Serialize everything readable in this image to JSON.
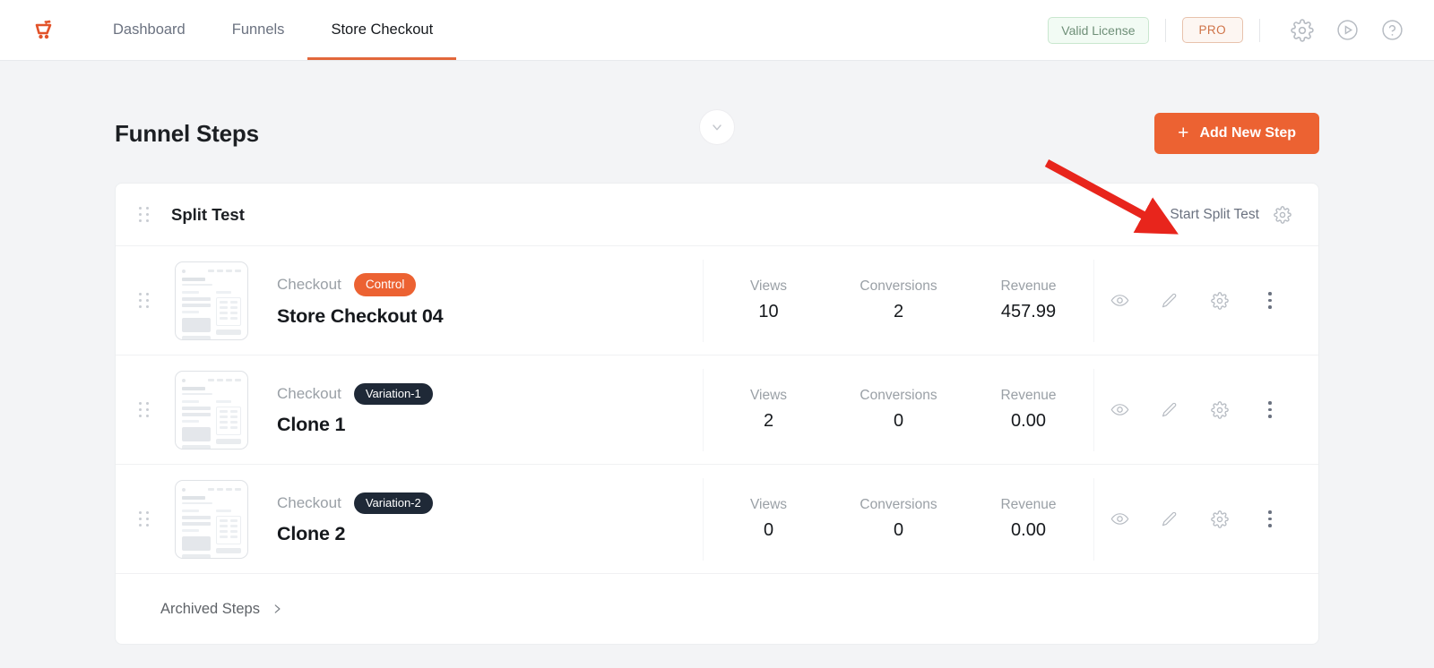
{
  "nav": {
    "logo_icon": "funnel-cart-logo",
    "items": [
      {
        "label": "Dashboard",
        "active": false
      },
      {
        "label": "Funnels",
        "active": false
      },
      {
        "label": "Store Checkout",
        "active": true
      }
    ],
    "license_badge": "Valid License",
    "plan_badge": "PRO",
    "icons": [
      "gear-icon",
      "play-circle-icon",
      "help-circle-icon"
    ],
    "collapse_icon": "chevron-down-icon"
  },
  "page": {
    "title": "Funnel Steps",
    "add_button": "Add New Step",
    "add_button_plus": "+"
  },
  "card": {
    "title": "Split Test",
    "grip_icon": "drag-handle-icon",
    "start_split_test": "Start Split Test",
    "settings_icon": "gear-icon",
    "columns": {
      "views": "Views",
      "conversions": "Conversions",
      "revenue": "Revenue"
    },
    "steps": [
      {
        "type": "Checkout",
        "badge": "Control",
        "badge_kind": "control",
        "name": "Store Checkout 04",
        "views": "10",
        "conversions": "2",
        "revenue": "457.99"
      },
      {
        "type": "Checkout",
        "badge": "Variation-1",
        "badge_kind": "variation",
        "name": "Clone 1",
        "views": "2",
        "conversions": "0",
        "revenue": "0.00"
      },
      {
        "type": "Checkout",
        "badge": "Variation-2",
        "badge_kind": "variation",
        "name": "Clone 2",
        "views": "0",
        "conversions": "0",
        "revenue": "0.00"
      }
    ],
    "row_actions": [
      "preview-eye-icon",
      "edit-pencil-icon",
      "gear-icon",
      "more-options-icon"
    ],
    "archived_steps": "Archived Steps",
    "archived_chevron_icon": "chevron-right-icon"
  },
  "annotation": {
    "type": "arrow",
    "color": "#e8251c",
    "points_to": "Start Split Test"
  },
  "colors": {
    "accent_orange": "#ec6232",
    "badge_dark": "#1f2937",
    "page_bg": "#f3f4f6",
    "license_green": "#6f8f78",
    "annotation_red": "#e8251c"
  }
}
